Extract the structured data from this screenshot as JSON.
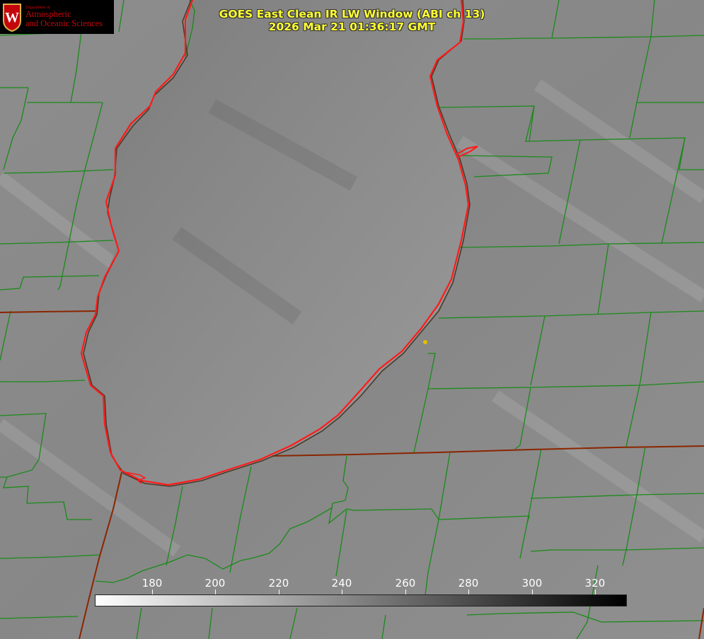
{
  "logo": {
    "line_small": "Department of",
    "line1": "Atmospheric",
    "line2": "and Oceanic Sciences",
    "crest_letter": "W"
  },
  "title": {
    "line1": "GOES East Clean IR LW Window (ABI ch 13)",
    "line2": "2026 Mar 21 01:36:17 GMT"
  },
  "colorbar": {
    "ticks": [
      "180",
      "200",
      "220",
      "240",
      "260",
      "280",
      "300",
      "320"
    ],
    "gradient": [
      "#ffffff",
      "#000000"
    ]
  },
  "colors": {
    "county_lines": "#1a8a1a",
    "state_lines": "#8b2500",
    "coastline": "#ff1a1a",
    "marker": "#e0c000",
    "title_text": "#ffff33"
  }
}
